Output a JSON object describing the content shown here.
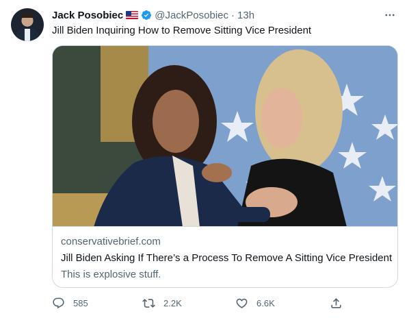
{
  "author": {
    "name": "Jack Posobiec",
    "handle": "@JackPosobiec",
    "separator": "·",
    "time": "13h"
  },
  "tweet_text": "Jill Biden Inquiring How to Remove Sitting Vice President",
  "card": {
    "domain": "conservativebrief.com",
    "title": "Jill Biden Asking If There’s a Process To Remove A Sitting Vice President",
    "description": "This is explosive stuff."
  },
  "actions": {
    "reply_count": "585",
    "retweet_count": "2.2K",
    "like_count": "6.6K"
  },
  "icons": {
    "verified": "verified-badge-icon",
    "flag": "us-flag-icon",
    "more": "more-icon",
    "reply": "reply-icon",
    "retweet": "retweet-icon",
    "like": "heart-icon",
    "share": "share-icon"
  },
  "colors": {
    "accent": "#1d9bf0",
    "secondary_text": "#536471",
    "border": "#cfd9de"
  }
}
